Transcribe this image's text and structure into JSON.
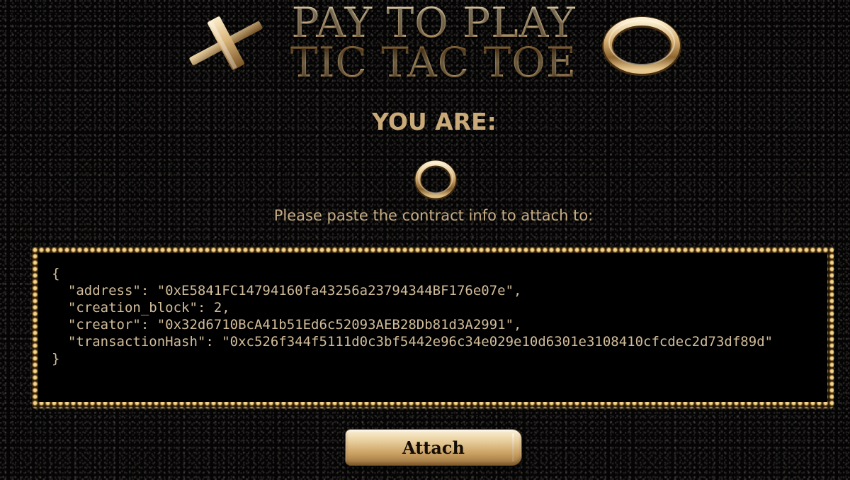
{
  "header": {
    "title_line1": "PAY TO PLAY",
    "title_line2": "TIC TAC TOE",
    "left_icon": "gold-x-icon",
    "right_icon": "gold-ring-o-icon"
  },
  "player": {
    "label": "YOU ARE:",
    "mark": "O",
    "mark_icon": "gold-ring-o-icon"
  },
  "attach_form": {
    "instruction": "Please paste the contract info to attach to:",
    "contract_info": "{\n  \"address\": \"0xE5841FC14794160fa43256a23794344BF176e07e\",\n  \"creation_block\": 2,\n  \"creator\": \"0x32d6710BcA41b51Ed6c52093AEB28Db81d3A2991\",\n  \"transactionHash\": \"0xc526f344f5111d0c3bf5442e96c34e029e10d6301e3108410cfcdec2d73df89d\"\n}",
    "button_label": "Attach"
  },
  "colors": {
    "gold": "#c9aa78",
    "background": "#060505",
    "textarea_bg": "#000000"
  }
}
